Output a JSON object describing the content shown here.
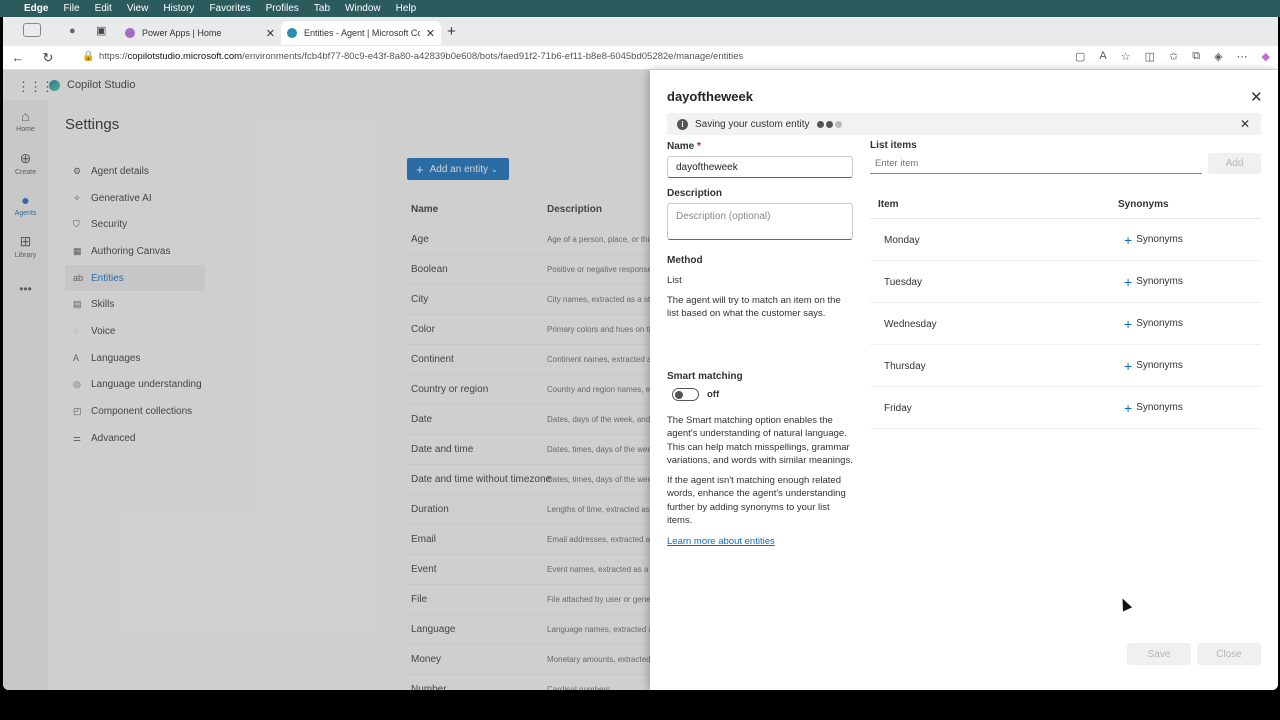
{
  "menubar": {
    "app": "Edge",
    "items": [
      "File",
      "Edit",
      "View",
      "History",
      "Favorites",
      "Profiles",
      "Tab",
      "Window",
      "Help"
    ]
  },
  "tabs": [
    {
      "label": "Power Apps | Home",
      "active": false
    },
    {
      "label": "Entities - Agent | Microsoft Copilot Studio",
      "active": true
    }
  ],
  "address": {
    "url_prefix": "https://",
    "url_domain": "copilotstudio.microsoft.com",
    "url_path": "/environments/fcb4bf77-80c9-e43f-8a80-a42839b0e608/bots/faed91f2-71b6-ef11-b8e8-6045bd05282e/manage/entities"
  },
  "app": {
    "brand": "Copilot Studio",
    "rail": [
      {
        "label": "Home",
        "icon": "home-icon"
      },
      {
        "label": "Create",
        "icon": "add-circle-icon"
      },
      {
        "label": "Agents",
        "icon": "agent-icon",
        "active": true
      },
      {
        "label": "Library",
        "icon": "library-icon"
      }
    ],
    "settings_title": "Settings",
    "settings_nav": [
      {
        "label": "Agent details",
        "icon": "gear-icon"
      },
      {
        "label": "Generative AI",
        "icon": "sparkle-icon"
      },
      {
        "label": "Security",
        "icon": "shield-icon"
      },
      {
        "label": "Authoring Canvas",
        "icon": "canvas-icon"
      },
      {
        "label": "Entities",
        "icon": "entity-icon",
        "active": true
      },
      {
        "label": "Skills",
        "icon": "skills-icon"
      },
      {
        "label": "Voice",
        "icon": "voice-icon"
      },
      {
        "label": "Languages",
        "icon": "languages-icon"
      },
      {
        "label": "Language understanding",
        "icon": "language-understanding-icon"
      },
      {
        "label": "Component collections",
        "icon": "collection-icon"
      },
      {
        "label": "Advanced",
        "icon": "advanced-icon"
      }
    ],
    "add_entity_label": "Add an entity",
    "table_headers": {
      "name": "Name",
      "description": "Description"
    },
    "entities": [
      {
        "name": "Age",
        "description": "Age of a person, place, or thing"
      },
      {
        "name": "Boolean",
        "description": "Positive or negative responses"
      },
      {
        "name": "City",
        "description": "City names, extracted as a string"
      },
      {
        "name": "Color",
        "description": "Primary colors and hues on the"
      },
      {
        "name": "Continent",
        "description": "Continent names, extracted as"
      },
      {
        "name": "Country or region",
        "description": "Country and region names, ex"
      },
      {
        "name": "Date",
        "description": "Dates, days of the week, and"
      },
      {
        "name": "Date and time",
        "description": "Dates, times, days of the week"
      },
      {
        "name": "Date and time without timezone",
        "description": "Dates, times, days of the week"
      },
      {
        "name": "Duration",
        "description": "Lengths of time, extracted as"
      },
      {
        "name": "Email",
        "description": "Email addresses, extracted as"
      },
      {
        "name": "Event",
        "description": "Event names, extracted as a s"
      },
      {
        "name": "File",
        "description": "File attached by user or gene"
      },
      {
        "name": "Language",
        "description": "Language names, extracted a"
      },
      {
        "name": "Money",
        "description": "Monetary amounts, extracted"
      },
      {
        "name": "Number",
        "description": "Cardinal numbers"
      }
    ]
  },
  "panel": {
    "title": "dayoftheweek",
    "message": "Saving your custom entity",
    "name_label": "Name",
    "name_required": "*",
    "name_value": "dayoftheweek",
    "description_label": "Description",
    "description_placeholder": "Description (optional)",
    "method_label": "Method",
    "method_value": "List",
    "method_help": "The agent will try to match an item on the list based on what the customer says.",
    "smart_label": "Smart matching",
    "smart_state": "off",
    "smart_help_1": "The Smart matching option enables the agent's understanding of natural language. This can help match misspellings, grammar variations, and words with similar meanings.",
    "smart_help_2": "If the agent isn't matching enough related words, enhance the agent's understanding further by adding synonyms to your list items.",
    "learn_more": "Learn more about entities",
    "list_items_label": "List items",
    "list_item_placeholder": "Enter item",
    "add_label": "Add",
    "col_item": "Item",
    "col_synonyms": "Synonyms",
    "items": [
      {
        "item": "Monday",
        "synonyms": "Synonyms"
      },
      {
        "item": "Tuesday",
        "synonyms": "Synonyms"
      },
      {
        "item": "Wednesday",
        "synonyms": "Synonyms"
      },
      {
        "item": "Thursday",
        "synonyms": "Synonyms"
      },
      {
        "item": "Friday",
        "synonyms": "Synonyms"
      }
    ],
    "save_label": "Save",
    "close_label": "Close"
  }
}
